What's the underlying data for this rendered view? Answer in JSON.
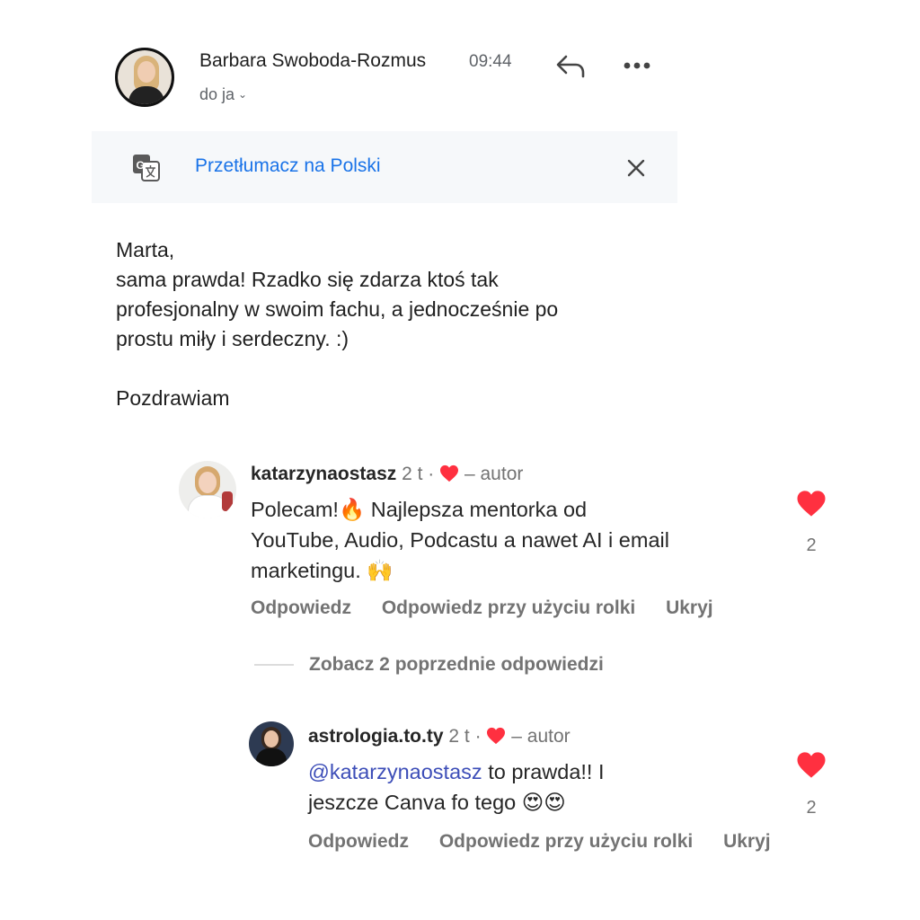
{
  "email": {
    "sender_name": "Barbara Swoboda-Rozmus",
    "time": "09:44",
    "recipient": "do ja",
    "translate_label": "Przetłumacz na Polski",
    "body_lines": [
      "Marta,",
      "sama prawda! Rzadko się zdarza ktoś tak",
      "profesjonalny w swoim fachu, a jednocześnie po",
      "prostu miły i serdeczny. :)"
    ],
    "signoff": "Pozdrawiam"
  },
  "comments": [
    {
      "username": "katarzynaostasz",
      "age": "2 t",
      "separator": "·",
      "author_label": "– autor",
      "text_lines": [
        "Polecam!🔥 Najlepsza mentorka od",
        "YouTube, Audio, Podcastu a nawet AI i email",
        "marketingu. 🙌"
      ],
      "likes": "2",
      "actions": {
        "reply": "Odpowiedz",
        "reply_reel": "Odpowiedz przy użyciu rolki",
        "hide": "Ukryj"
      }
    },
    {
      "username": "astrologia.to.ty",
      "age": "2 t",
      "separator": "·",
      "author_label": "– autor",
      "mention": "@katarzynaostasz",
      "text_after_mention": " to prawda!! I",
      "text_line2": "jeszcze Canva fo tego 😍😍",
      "likes": "2",
      "actions": {
        "reply": "Odpowiedz",
        "reply_reel": "Odpowiedz przy użyciu rolki",
        "hide": "Ukryj"
      }
    }
  ],
  "view_replies": "Zobacz 2 poprzednie odpowiedzi",
  "colors": {
    "link": "#1a73e8",
    "heart": "#ff3040",
    "mention": "#3d4eb8",
    "muted": "#737373"
  },
  "icons": [
    "reply-icon",
    "more-icon",
    "translate-icon",
    "close-icon",
    "heart-icon",
    "chevron-down-icon"
  ]
}
